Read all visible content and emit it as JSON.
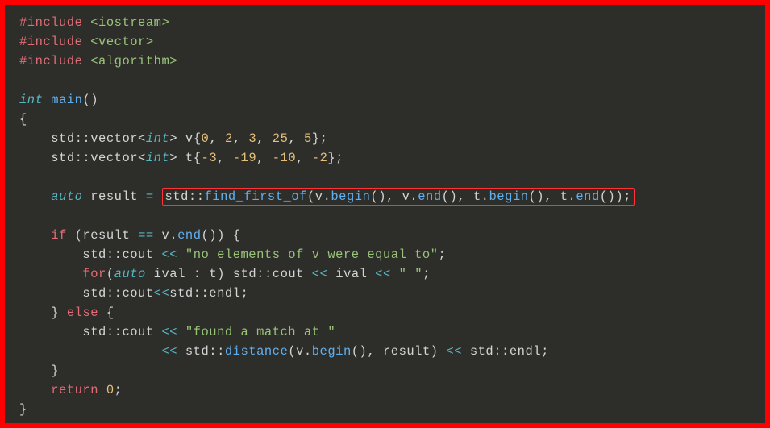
{
  "colors": {
    "bg": "#2d2d2a",
    "border": "#ff0000",
    "preproc": "#e06c75",
    "keyword": "#e06c75",
    "type": "#56b6c2",
    "string": "#98c379",
    "number": "#e5c07b",
    "func": "#61afef",
    "default": "#d4d4d4"
  },
  "code": {
    "includes": [
      "iostream",
      "vector",
      "algorithm"
    ],
    "func_decl_type": "int",
    "func_decl_name": "main",
    "vec1_name": "v",
    "vec1_values": [
      0,
      2,
      3,
      25,
      5
    ],
    "vec2_name": "t",
    "vec2_values": [
      -3,
      -19,
      -10,
      -2
    ],
    "result_var": "result",
    "find_call": "std::find_first_of(v.begin(), v.end(), t.begin(), t.end());",
    "if_cond": "(result == v.end())",
    "str1": "\"no elements of v were equal to\"",
    "for_decl": "auto ival : t",
    "for_body_var": "ival",
    "str_space": "\" \"",
    "endl_line": "std::cout<<std::endl;",
    "else_kw": "else",
    "str2": "\"found a match at \"",
    "distance_call": "std::distance(v.begin(), result)",
    "return_kw": "return",
    "return_val": "0"
  },
  "tokens": {
    "hash_include": "#include",
    "lt": "<",
    "gt": ">",
    "std": "std",
    "scope": "::",
    "vector": "vector",
    "int": "int",
    "cout": "cout",
    "endl": "endl",
    "if": "if",
    "for": "for",
    "else": "else",
    "return": "return",
    "auto": "auto",
    "begin": "begin",
    "end": "end",
    "find_first_of": "find_first_of",
    "distance": "distance"
  }
}
